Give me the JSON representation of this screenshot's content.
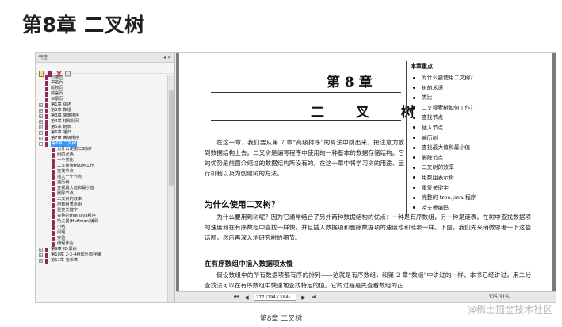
{
  "page": {
    "heading": "第8章 二叉树",
    "caption": "第8章 二叉树",
    "watermark": "@稀土掘金技术社区"
  },
  "bookmarks": {
    "header": "书签",
    "items": [
      {
        "label": "封面页",
        "indent": 1,
        "expand": ""
      },
      {
        "label": "书名页",
        "indent": 1,
        "expand": ""
      },
      {
        "label": "版权页",
        "indent": 1,
        "expand": ""
      },
      {
        "label": "前言页",
        "indent": 1,
        "expand": ""
      },
      {
        "label": "目录页",
        "indent": 1,
        "expand": ""
      },
      {
        "label": "第1章  综述",
        "indent": 1,
        "expand": "+"
      },
      {
        "label": "第2章  数组",
        "indent": 1,
        "expand": "+"
      },
      {
        "label": "第3章  简单排序",
        "indent": 1,
        "expand": "+"
      },
      {
        "label": "第4章  栈和队列",
        "indent": 1,
        "expand": "+"
      },
      {
        "label": "第5章  链表",
        "indent": 1,
        "expand": "+"
      },
      {
        "label": "第6章  递归",
        "indent": 1,
        "expand": "+"
      },
      {
        "label": "第7章  高级排序",
        "indent": 1,
        "expand": "+"
      },
      {
        "label": "第8章  二叉树",
        "indent": 1,
        "expand": "-",
        "selected": true
      },
      {
        "label": "为什么使用二叉树?",
        "indent": 2,
        "expand": ""
      },
      {
        "label": "树的术语",
        "indent": 2,
        "expand": ""
      },
      {
        "label": "一个类比",
        "indent": 2,
        "expand": ""
      },
      {
        "label": "二叉搜索树如何工作",
        "indent": 2,
        "expand": ""
      },
      {
        "label": "查找节点",
        "indent": 2,
        "expand": ""
      },
      {
        "label": "插入一个节点",
        "indent": 2,
        "expand": ""
      },
      {
        "label": "遍历树",
        "indent": 2,
        "expand": ""
      },
      {
        "label": "查找最大值和最小值",
        "indent": 2,
        "expand": ""
      },
      {
        "label": "删除节点",
        "indent": 2,
        "expand": ""
      },
      {
        "label": "二叉树的效率",
        "indent": 2,
        "expand": ""
      },
      {
        "label": "用数组表示树",
        "indent": 2,
        "expand": ""
      },
      {
        "label": "重复关键字",
        "indent": 2,
        "expand": ""
      },
      {
        "label": "完整的tree.java程序",
        "indent": 2,
        "expand": ""
      },
      {
        "label": "哈夫曼(Huffman)编码",
        "indent": 2,
        "expand": ""
      },
      {
        "label": "小结",
        "indent": 2,
        "expand": ""
      },
      {
        "label": "问题",
        "indent": 2,
        "expand": ""
      },
      {
        "label": "实验",
        "indent": 2,
        "expand": ""
      },
      {
        "label": "编程作业",
        "indent": 2,
        "expand": ""
      },
      {
        "label": "第9章  红-黑树",
        "indent": 1,
        "expand": "+"
      },
      {
        "label": "第10章  2-3-4树和外部存储",
        "indent": 1,
        "expand": "+"
      },
      {
        "label": "第11章  哈希表",
        "indent": 1,
        "expand": "+"
      }
    ]
  },
  "document": {
    "chapter_number": "第 8 章",
    "chapter_title": "二 叉 树",
    "intro": "在这一章，我们要从第 7 章“高级排序”的算法中跳出来，把注意力放到数据结构上去。二叉树是编写程序中使用的一种基本的数据存储结构。它的优势是前面介绍过的数据结构所没有的。在这一章中将学习树的用途、运行机制以及为创建树的方法。",
    "section1_title": "为什么使用二叉树？",
    "section1_body": "为什么要用到树呢？因为它通常结合了另外两种数据结构的优点：一种是有序数组，另一种是链表。在树中查找数据项的速度和在有序数组中查找一样快，并且插入数据项和删除数据项的速度也和链表一样。下面，我们先来稍微思考一下这些话题，然后再深入地研究树的细节。",
    "section2_title": "在有序数组中插入数据项太慢",
    "section2_body": "假设数组中的所有数据项都有序的排列——这就是有序数组，和第 2 章“数组”中讲过的一样。本书已经讲过，用二分查找法可以在有序数组中快速地查找特定的值。它的过程是先查看数组的正"
  },
  "key_points": {
    "title": "本章重点",
    "items": [
      "为什么要使用二叉树？",
      "树的术语",
      "类比",
      "二叉搜索树如何工作？",
      "查找节点",
      "插入节点",
      "遍历树",
      "查找最大值和最小值",
      "删除节点",
      "二叉树的效率",
      "用数组表示树",
      "重复关键字",
      "完整的 tree.java 程序",
      "哈夫曼编码"
    ]
  },
  "toolbar": {
    "first": "⏮",
    "prev": "◀",
    "next": "▶",
    "last": "⏭",
    "page_indicator": "277 (294 / 584)",
    "zoom": "126.31%"
  }
}
